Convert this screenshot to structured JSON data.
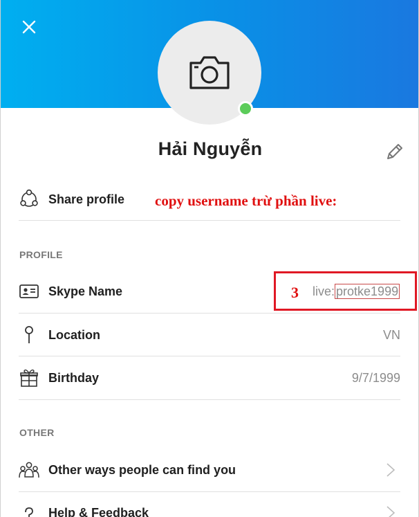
{
  "profile": {
    "display_name": "Hải Nguyễn",
    "presence_color": "#5ccc5a"
  },
  "share": {
    "label": "Share profile"
  },
  "annotation": {
    "text": "copy username trừ phần live:",
    "step_number": "3",
    "color": "#e01010"
  },
  "sections": {
    "profile_title": "PROFILE",
    "other_title": "OTHER"
  },
  "fields": {
    "skype_name_label": "Skype Name",
    "skype_name_prefix": "live:",
    "skype_name_value": "protke1999",
    "location_label": "Location",
    "location_value": "VN",
    "birthday_label": "Birthday",
    "birthday_value": "9/7/1999"
  },
  "other": {
    "find_you_label": "Other ways people can find you",
    "help_label": "Help & Feedback"
  },
  "colors": {
    "header_start": "#00aff0",
    "header_end": "#1a78e0",
    "highlight": "#e01824"
  }
}
